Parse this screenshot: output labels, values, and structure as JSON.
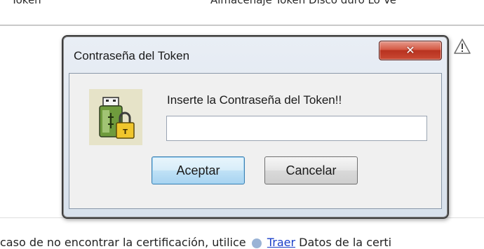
{
  "background": {
    "top_left_text": "Token",
    "top_right_text": "Almacenaje Token   Disco duro   Lo Ve",
    "bottom_text_before": "caso de no encontrar la certificación, utilice",
    "bottom_link": "Traer",
    "bottom_text_after": " Datos de la certi"
  },
  "dialog": {
    "title": "Contraseña del Token",
    "close_glyph": "✕",
    "prompt": "Inserte la Contraseña del Token!!",
    "password_value": "",
    "accept_label": "Aceptar",
    "cancel_label": "Cancelar"
  },
  "colors": {
    "close_button": "#c94a34",
    "accept_border": "#3c7fb1",
    "dialog_bg": "#f0f0f0",
    "icon_bg": "#e6e3c8"
  },
  "icons": {
    "token": "usb-token-lock-icon",
    "warning": "warning-icon"
  }
}
